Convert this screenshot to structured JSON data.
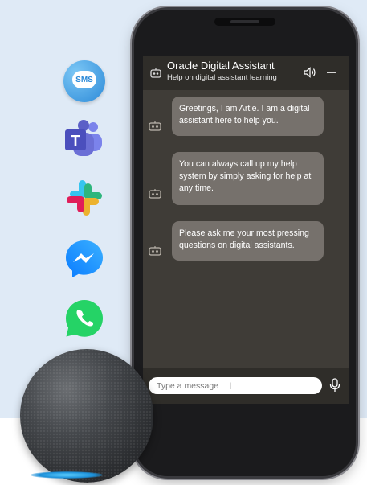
{
  "channels": [
    {
      "name": "sms",
      "label": "SMS",
      "color": "#2c8ad8"
    },
    {
      "name": "teams",
      "color": "#5b5fc7"
    },
    {
      "name": "slack",
      "colors": [
        "#36c5f0",
        "#2eb67d",
        "#ecb22e",
        "#e01e5a"
      ]
    },
    {
      "name": "messenger",
      "color": "#1a8cff"
    },
    {
      "name": "whatsapp",
      "color": "#25d366"
    }
  ],
  "assistant": {
    "title": "Oracle Digital Assistant",
    "subtitle": "Help on digital assistant learning"
  },
  "messages": [
    {
      "text": "Greetings, I am Artie. I am a digital assistant here to help you."
    },
    {
      "text": "You can always call up my help system by simply asking for help at any time."
    },
    {
      "text": "Please ask me your most pressing questions on digital assistants."
    }
  ],
  "composer": {
    "placeholder": "Type a message"
  },
  "colors": {
    "background": "#dfeaf6",
    "screen": "#3f3c37",
    "header": "#2f2d29",
    "bubble": "#76716c",
    "echo_ring": "#1c8fd8"
  },
  "icons": {
    "header": "bot-icon",
    "speaker": "speaker-icon",
    "minimize": "minimize-icon",
    "mic": "microphone-icon",
    "avatar": "bot-avatar-icon"
  }
}
